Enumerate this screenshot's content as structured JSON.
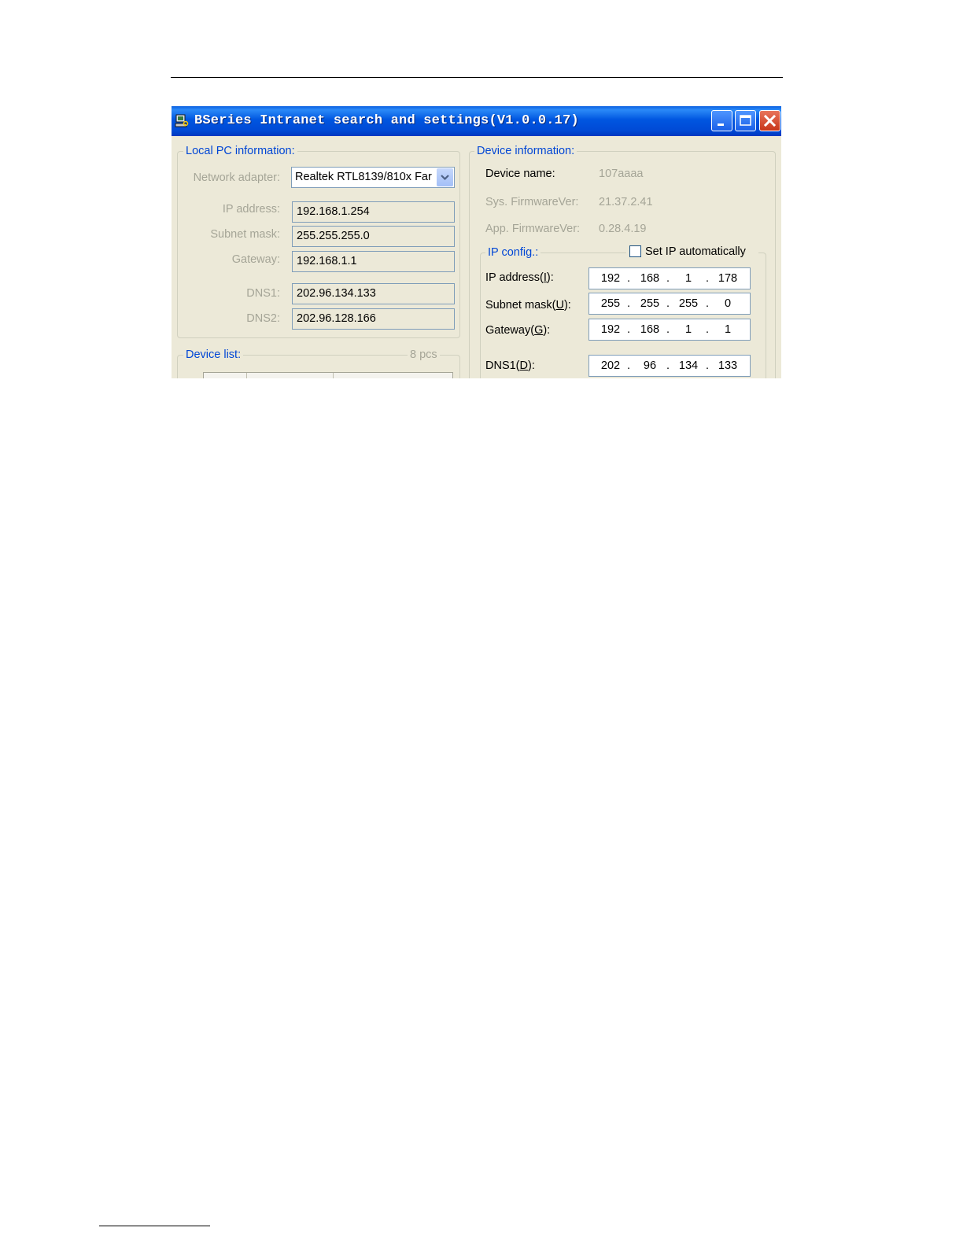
{
  "window": {
    "title": "BSeries Intranet search and settings(V1.0.0.17)"
  },
  "local_pc": {
    "legend": "Local PC information:",
    "network_adapter_label": "Network adapter:",
    "network_adapter_value": "Realtek RTL8139/810x Far",
    "ip_label": "IP address:",
    "ip_value": "192.168.1.254",
    "subnet_label": "Subnet mask:",
    "subnet_value": "255.255.255.0",
    "gateway_label": "Gateway:",
    "gateway_value": "192.168.1.1",
    "dns1_label": "DNS1:",
    "dns1_value": "202.96.134.133",
    "dns2_label": "DNS2:",
    "dns2_value": "202.96.128.166"
  },
  "device_list": {
    "legend": "Device list:",
    "count": "8 pcs"
  },
  "device_info": {
    "legend": "Device information:",
    "name_label": "Device name:",
    "name_value": "107aaaa",
    "sys_fw_label": "Sys. FirmwareVer:",
    "sys_fw_value": "21.37.2.41",
    "app_fw_label": "App. FirmwareVer:",
    "app_fw_value": "0.28.4.19"
  },
  "ip_config": {
    "legend": "IP config.:",
    "auto_label": "Set IP automatically",
    "auto_checked": false,
    "ip_label_pre": "IP address(",
    "ip_label_key": "I",
    "ip_octets": [
      "192",
      "168",
      "1",
      "178"
    ],
    "subnet_label_pre": "Subnet mask(",
    "subnet_label_key": "U",
    "subnet_octets": [
      "255",
      "255",
      "255",
      "0"
    ],
    "gateway_label_pre": "Gateway(",
    "gateway_label_key": "G",
    "gateway_octets": [
      "192",
      "168",
      "1",
      "1"
    ],
    "dns1_label_pre": "DNS1(",
    "dns1_label_key": "D",
    "dns1_octets": [
      "202",
      "96",
      "134",
      "133"
    ],
    "label_post": "):"
  },
  "colors": {
    "titlebar": "#0054e3",
    "window_bg": "#ece9d8",
    "legend_text": "#0046d5",
    "disabled_text": "#a5a597"
  }
}
